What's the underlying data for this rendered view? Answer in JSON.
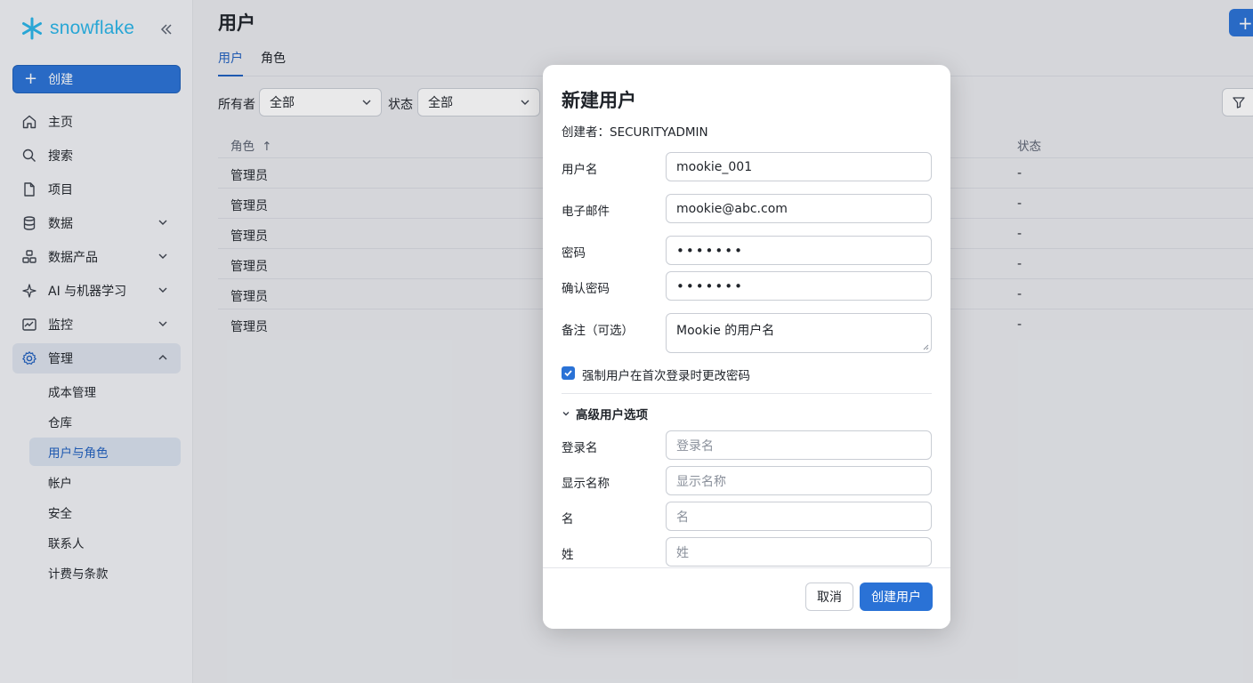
{
  "sidebar": {
    "logo_text": "snowflake",
    "create_label": "创建",
    "nav": [
      {
        "label": "主页",
        "icon": "home-icon"
      },
      {
        "label": "搜索",
        "icon": "search-icon"
      },
      {
        "label": "项目",
        "icon": "document-icon"
      },
      {
        "label": "数据",
        "icon": "database-icon"
      },
      {
        "label": "数据产品",
        "icon": "cloud-icon"
      },
      {
        "label": "AI 与机器学习",
        "icon": "ai-icon"
      },
      {
        "label": "监控",
        "icon": "monitor-icon"
      },
      {
        "label": "管理",
        "icon": "gear-icon"
      }
    ],
    "sub": [
      "成本管理",
      "仓库",
      "用户与角色",
      "帐户",
      "安全",
      "联系人",
      "计费与条款"
    ]
  },
  "main": {
    "title": "用户",
    "tabs": [
      "用户",
      "角色"
    ],
    "filters": [
      {
        "label": "所有者",
        "value": "全部"
      },
      {
        "label": "状态",
        "value": "全部"
      }
    ],
    "table": {
      "headers": [
        "角色",
        "状态"
      ],
      "rows": [
        [
          "管理员",
          "-"
        ],
        [
          "管理员",
          "-"
        ],
        [
          "管理员",
          "-"
        ],
        [
          "管理员",
          "-"
        ],
        [
          "管理员",
          "-"
        ],
        [
          "管理员",
          "-"
        ]
      ]
    }
  },
  "modal": {
    "title": "新建用户",
    "creator": "创建者：SECURITYADMIN",
    "fields": {
      "username": {
        "label": "用户名",
        "value": "mookie_001"
      },
      "email": {
        "label": "电子邮件",
        "value": "mookie@abc.com"
      },
      "password": {
        "label": "密码",
        "value": "•••••••"
      },
      "confirm": {
        "label": "确认密码",
        "value": "•••••••"
      },
      "note": {
        "label": "备注（可选）",
        "value": "Mookie 的用户名"
      }
    },
    "force_change_label": "强制用户在首次登录时更改密码",
    "force_change_checked": true,
    "advanced_label": "高级用户选项",
    "advanced": {
      "login": {
        "label": "登录名",
        "placeholder": "登录名"
      },
      "display": {
        "label": "显示名称",
        "placeholder": "显示名称"
      },
      "first": {
        "label": "名",
        "placeholder": "名"
      },
      "last": {
        "label": "姓",
        "placeholder": "姓"
      }
    },
    "cancel_label": "取消",
    "submit_label": "创建用户"
  },
  "colors": {
    "accent": "#2a72d6",
    "logo": "#29b5e8"
  }
}
